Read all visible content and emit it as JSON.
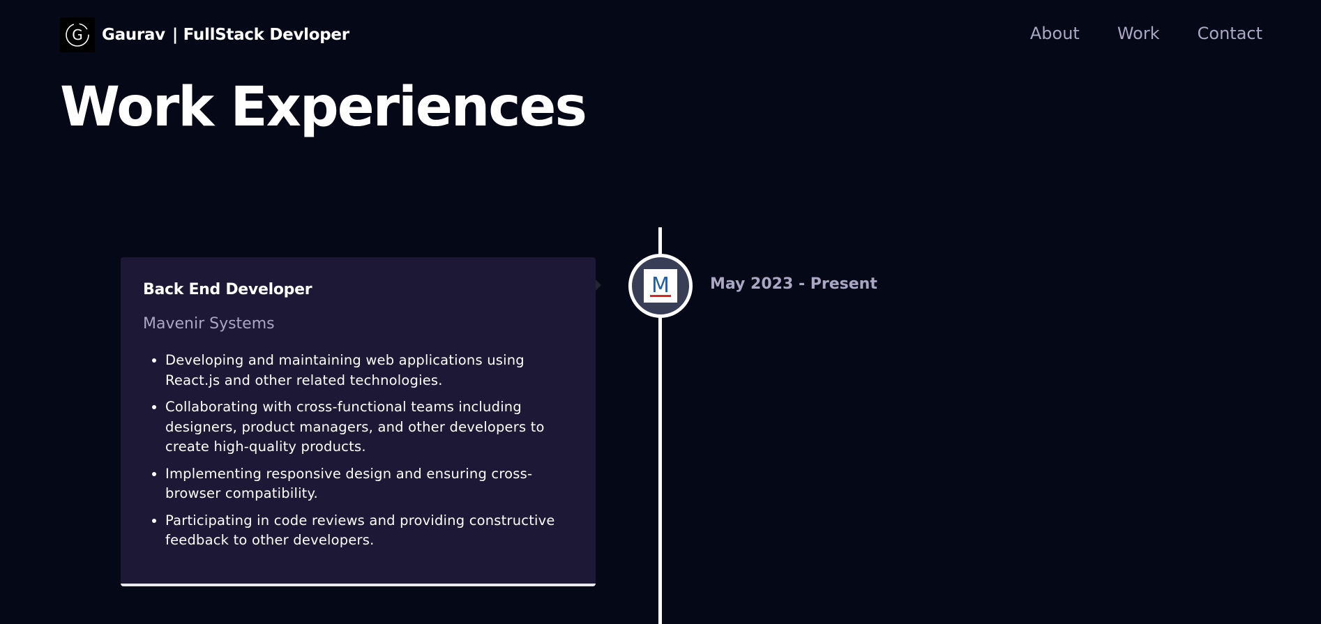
{
  "navbar": {
    "brand_name": "Gaurav",
    "brand_role": "| FullStack Devloper",
    "logo_letter": "G",
    "links": [
      {
        "label": "About"
      },
      {
        "label": "Work"
      },
      {
        "label": "Contact"
      }
    ]
  },
  "page": {
    "title": "Work Experiences"
  },
  "experience": {
    "role": "Back End Developer",
    "company": "Mavenir Systems",
    "company_logo_letter": "M",
    "date": "May 2023 - Present",
    "points": [
      "Developing and maintaining web applications using React.js and other related technologies.",
      "Collaborating with cross-functional teams including designers, product managers, and other developers to create high-quality products.",
      "Implementing responsive design and ensuring cross-browser compatibility.",
      "Participating in code reviews and providing constructive feedback to other developers."
    ]
  },
  "colors": {
    "background": "#050816",
    "card": "#1d1836",
    "secondary_text": "#aaa6c3",
    "timeline_node": "#383e56",
    "logo_blue": "#1b5fa8",
    "logo_red": "#d9242b"
  },
  "icons": {
    "brand_logo": "g-logo-icon",
    "company_logo": "mavenir-logo-icon"
  }
}
